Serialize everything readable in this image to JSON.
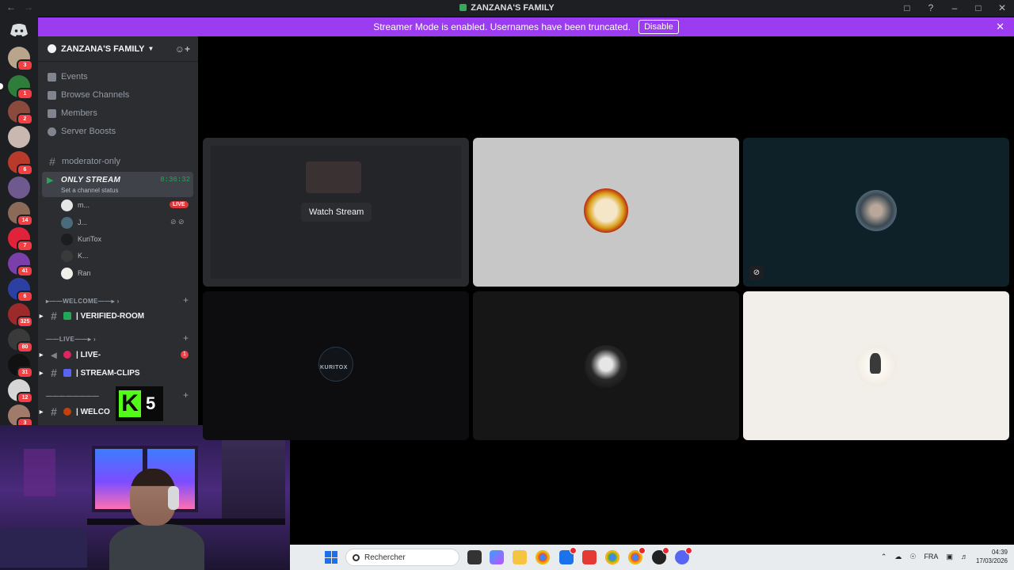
{
  "titlebar": {
    "title": "ZANZANA'S FAMILY"
  },
  "banner": {
    "message": "Streamer Mode is enabled. Usernames have been truncated.",
    "button": "Disable"
  },
  "server_rail": {
    "badges": [
      "3",
      "1",
      "2",
      "6",
      "14",
      "7",
      "41",
      "6",
      "325",
      "80",
      "31",
      "12",
      "3"
    ]
  },
  "sidebar": {
    "server_name": "ZANZANA'S FAMILY",
    "menu": [
      "Events",
      "Browse Channels",
      "Members",
      "Server Boosts"
    ],
    "moderator_channel": "moderator-only",
    "voice_channel": {
      "name": "ONLY STREAM",
      "timer": "8:36:32",
      "status": "Set a channel status"
    },
    "voice_users": [
      {
        "name": "m...",
        "live": "LIVE"
      },
      {
        "name": "J..."
      },
      {
        "name": "KuriTox"
      },
      {
        "name": "K..."
      },
      {
        "name": "Ran"
      }
    ],
    "categories": {
      "welcome": "WELCOME",
      "live": "LIVE",
      "bottom": ""
    },
    "text_channels": {
      "verified": "| VERIFIED-ROOM",
      "live": "| LIVE-",
      "live_unread": "1",
      "clips": "| STREAM-CLIPS",
      "welcome": "| WELCO"
    }
  },
  "overlay": {
    "k5_number": "5"
  },
  "video_grid": {
    "watch_stream": "Watch Stream",
    "tile_label_kuritox": "KURITOX"
  },
  "taskbar": {
    "search_placeholder": "Rechercher",
    "language": "FRA",
    "time": "04:39",
    "date": "17/03/2026"
  },
  "colors": {
    "banner": "#9b3cf0",
    "live": "#da373c",
    "voice_green": "#23a55a"
  }
}
